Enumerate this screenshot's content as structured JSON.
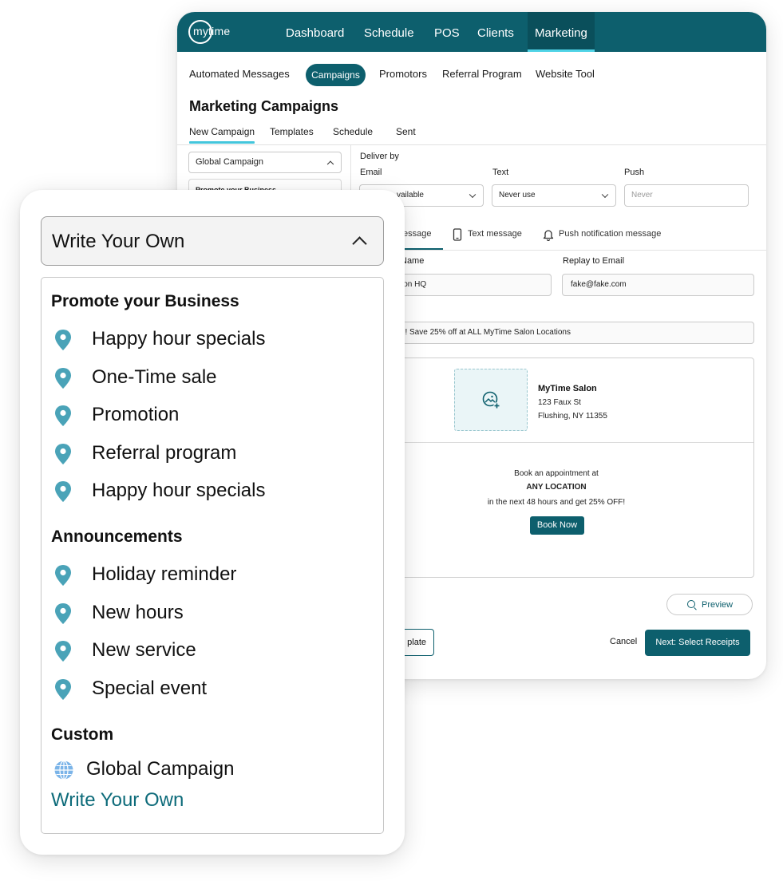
{
  "app": {
    "logo_text": "mytime",
    "nav": [
      "Dashboard",
      "Schedule",
      "POS",
      "Clients",
      "Marketing"
    ],
    "active_nav": "Marketing"
  },
  "subnav": {
    "items": [
      "Automated Messages",
      "Campaigns",
      "Promotors",
      "Referral Program",
      "Website Tool"
    ],
    "active": "Campaigns"
  },
  "page": {
    "title": "Marketing Campaigns",
    "tabs": [
      "New Campaign",
      "Templates",
      "Schedule",
      "Sent"
    ],
    "active_tab": "New Campaign"
  },
  "left_panel": {
    "campaign_select": "Global Campaign",
    "partial_item": "Promote your Business"
  },
  "deliver": {
    "title": "Deliver by",
    "email_label": "Email",
    "email_value": "vailable",
    "text_label": "Text",
    "text_value": "Never use",
    "push_label": "Push",
    "push_placeholder": "Never"
  },
  "message_tabs": {
    "email": "essage",
    "text": "Text message",
    "push": "Push notification message"
  },
  "form": {
    "name_label": "Name",
    "name_value": "lon HQ",
    "reply_label": "Replay to Email",
    "reply_value": "fake@fake.com",
    "subject_value": "E!! Save 25% off at ALL MyTime Salon Locations"
  },
  "email_preview": {
    "salon_name": "MyTime Salon",
    "address1": "123 Faux St",
    "address2": "Flushing, NY 11355",
    "line1": "Book an appointment at",
    "line2": "ANY LOCATION",
    "line3": "in the next 48 hours and get 25% OFF!",
    "book_button": "Book Now"
  },
  "actions": {
    "preview": "Preview",
    "template_partial": "plate",
    "cancel": "Cancel",
    "next": "Next: Select Receipts"
  },
  "dropdown": {
    "selected": "Write Your Own",
    "groups": [
      {
        "title": "Promote your Business",
        "items": [
          "Happy hour specials",
          "One-Time sale",
          "Promotion",
          "Referral program",
          "Happy hour specials"
        ]
      },
      {
        "title": "Announcements",
        "items": [
          "Holiday reminder",
          "New hours",
          "New service",
          "Special event"
        ]
      }
    ],
    "custom": {
      "title": "Custom",
      "global": "Global Campaign",
      "write_own": "Write Your Own"
    }
  },
  "colors": {
    "brand": "#0d5f6d",
    "accent": "#43c6dc",
    "pin": "#4aa3b8"
  },
  "icons": {
    "pin": "map-pin-icon",
    "globe": "globe-icon",
    "phone": "phone-icon",
    "bell": "bell-icon",
    "image": "image-add-icon",
    "search": "search-icon"
  }
}
